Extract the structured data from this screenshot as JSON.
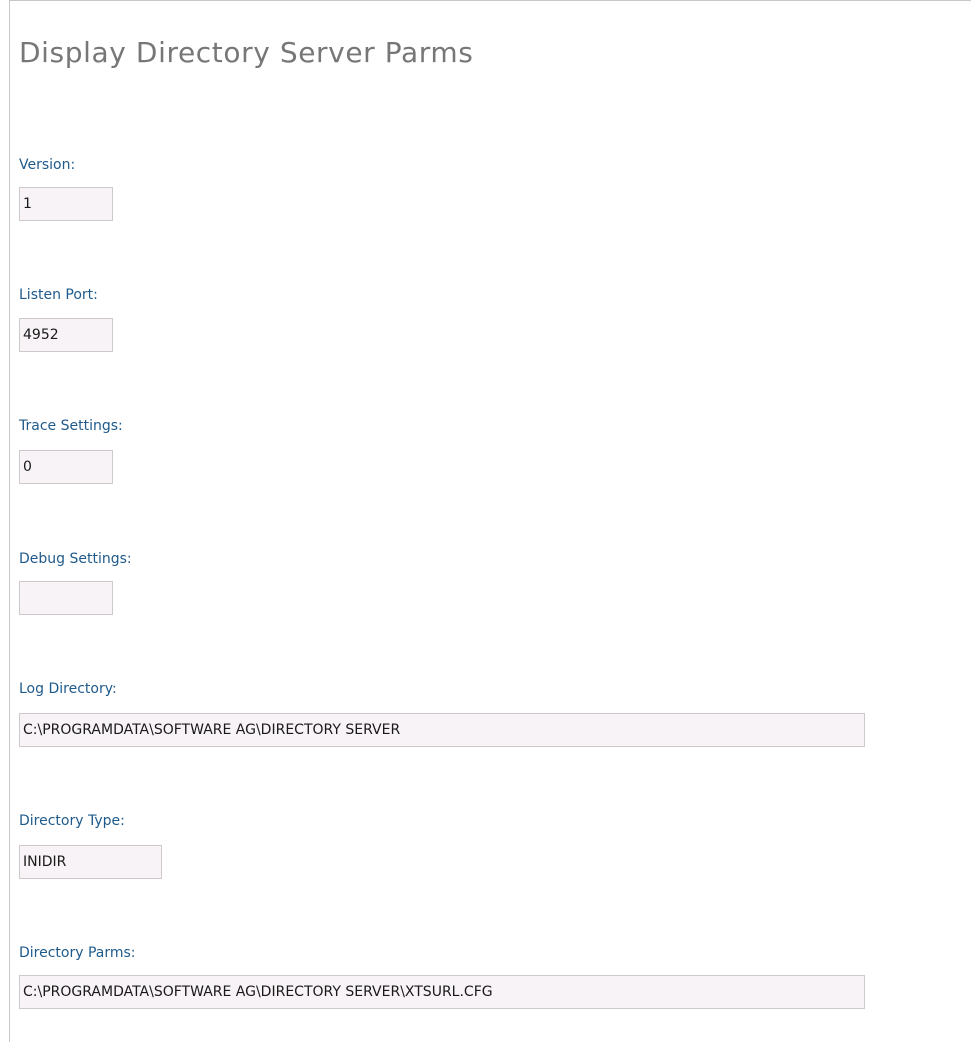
{
  "page": {
    "title": "Display Directory Server Parms"
  },
  "fields": [
    {
      "label": "Version:",
      "value": "1"
    },
    {
      "label": "Listen Port:",
      "value": "4952"
    },
    {
      "label": "Trace Settings:",
      "value": "0"
    },
    {
      "label": "Debug Settings:",
      "value": ""
    },
    {
      "label": "Log Directory:",
      "value": "C:\\PROGRAMDATA\\SOFTWARE AG\\DIRECTORY SERVER"
    },
    {
      "label": "Directory Type:",
      "value": "INIDIR"
    },
    {
      "label": "Directory Parms:",
      "value": "C:\\PROGRAMDATA\\SOFTWARE AG\\DIRECTORY SERVER\\XTSURL.CFG"
    }
  ]
}
